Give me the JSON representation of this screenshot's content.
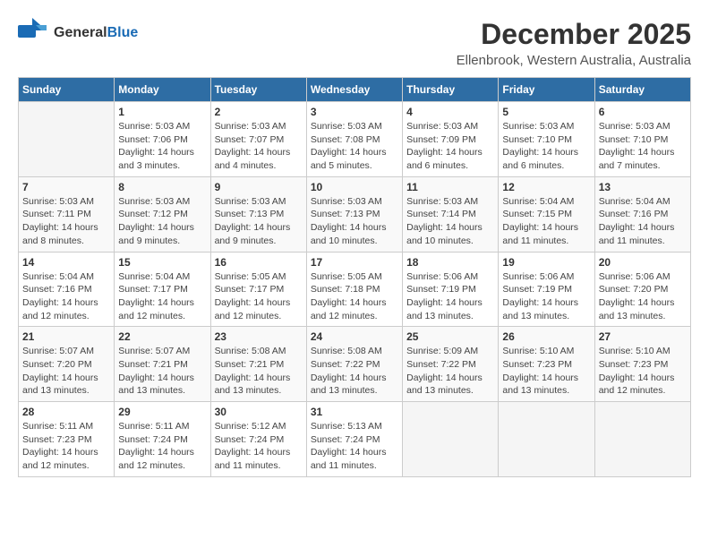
{
  "header": {
    "logo_general": "General",
    "logo_blue": "Blue",
    "main_title": "December 2025",
    "subtitle": "Ellenbrook, Western Australia, Australia"
  },
  "calendar": {
    "days_of_week": [
      "Sunday",
      "Monday",
      "Tuesday",
      "Wednesday",
      "Thursday",
      "Friday",
      "Saturday"
    ],
    "weeks": [
      [
        {
          "day": "",
          "sunrise": "",
          "sunset": "",
          "daylight": "",
          "empty": true
        },
        {
          "day": "1",
          "sunrise": "Sunrise: 5:03 AM",
          "sunset": "Sunset: 7:06 PM",
          "daylight": "Daylight: 14 hours and 3 minutes."
        },
        {
          "day": "2",
          "sunrise": "Sunrise: 5:03 AM",
          "sunset": "Sunset: 7:07 PM",
          "daylight": "Daylight: 14 hours and 4 minutes."
        },
        {
          "day": "3",
          "sunrise": "Sunrise: 5:03 AM",
          "sunset": "Sunset: 7:08 PM",
          "daylight": "Daylight: 14 hours and 5 minutes."
        },
        {
          "day": "4",
          "sunrise": "Sunrise: 5:03 AM",
          "sunset": "Sunset: 7:09 PM",
          "daylight": "Daylight: 14 hours and 6 minutes."
        },
        {
          "day": "5",
          "sunrise": "Sunrise: 5:03 AM",
          "sunset": "Sunset: 7:10 PM",
          "daylight": "Daylight: 14 hours and 6 minutes."
        },
        {
          "day": "6",
          "sunrise": "Sunrise: 5:03 AM",
          "sunset": "Sunset: 7:10 PM",
          "daylight": "Daylight: 14 hours and 7 minutes."
        }
      ],
      [
        {
          "day": "7",
          "sunrise": "Sunrise: 5:03 AM",
          "sunset": "Sunset: 7:11 PM",
          "daylight": "Daylight: 14 hours and 8 minutes."
        },
        {
          "day": "8",
          "sunrise": "Sunrise: 5:03 AM",
          "sunset": "Sunset: 7:12 PM",
          "daylight": "Daylight: 14 hours and 9 minutes."
        },
        {
          "day": "9",
          "sunrise": "Sunrise: 5:03 AM",
          "sunset": "Sunset: 7:13 PM",
          "daylight": "Daylight: 14 hours and 9 minutes."
        },
        {
          "day": "10",
          "sunrise": "Sunrise: 5:03 AM",
          "sunset": "Sunset: 7:13 PM",
          "daylight": "Daylight: 14 hours and 10 minutes."
        },
        {
          "day": "11",
          "sunrise": "Sunrise: 5:03 AM",
          "sunset": "Sunset: 7:14 PM",
          "daylight": "Daylight: 14 hours and 10 minutes."
        },
        {
          "day": "12",
          "sunrise": "Sunrise: 5:04 AM",
          "sunset": "Sunset: 7:15 PM",
          "daylight": "Daylight: 14 hours and 11 minutes."
        },
        {
          "day": "13",
          "sunrise": "Sunrise: 5:04 AM",
          "sunset": "Sunset: 7:16 PM",
          "daylight": "Daylight: 14 hours and 11 minutes."
        }
      ],
      [
        {
          "day": "14",
          "sunrise": "Sunrise: 5:04 AM",
          "sunset": "Sunset: 7:16 PM",
          "daylight": "Daylight: 14 hours and 12 minutes."
        },
        {
          "day": "15",
          "sunrise": "Sunrise: 5:04 AM",
          "sunset": "Sunset: 7:17 PM",
          "daylight": "Daylight: 14 hours and 12 minutes."
        },
        {
          "day": "16",
          "sunrise": "Sunrise: 5:05 AM",
          "sunset": "Sunset: 7:17 PM",
          "daylight": "Daylight: 14 hours and 12 minutes."
        },
        {
          "day": "17",
          "sunrise": "Sunrise: 5:05 AM",
          "sunset": "Sunset: 7:18 PM",
          "daylight": "Daylight: 14 hours and 12 minutes."
        },
        {
          "day": "18",
          "sunrise": "Sunrise: 5:06 AM",
          "sunset": "Sunset: 7:19 PM",
          "daylight": "Daylight: 14 hours and 13 minutes."
        },
        {
          "day": "19",
          "sunrise": "Sunrise: 5:06 AM",
          "sunset": "Sunset: 7:19 PM",
          "daylight": "Daylight: 14 hours and 13 minutes."
        },
        {
          "day": "20",
          "sunrise": "Sunrise: 5:06 AM",
          "sunset": "Sunset: 7:20 PM",
          "daylight": "Daylight: 14 hours and 13 minutes."
        }
      ],
      [
        {
          "day": "21",
          "sunrise": "Sunrise: 5:07 AM",
          "sunset": "Sunset: 7:20 PM",
          "daylight": "Daylight: 14 hours and 13 minutes."
        },
        {
          "day": "22",
          "sunrise": "Sunrise: 5:07 AM",
          "sunset": "Sunset: 7:21 PM",
          "daylight": "Daylight: 14 hours and 13 minutes."
        },
        {
          "day": "23",
          "sunrise": "Sunrise: 5:08 AM",
          "sunset": "Sunset: 7:21 PM",
          "daylight": "Daylight: 14 hours and 13 minutes."
        },
        {
          "day": "24",
          "sunrise": "Sunrise: 5:08 AM",
          "sunset": "Sunset: 7:22 PM",
          "daylight": "Daylight: 14 hours and 13 minutes."
        },
        {
          "day": "25",
          "sunrise": "Sunrise: 5:09 AM",
          "sunset": "Sunset: 7:22 PM",
          "daylight": "Daylight: 14 hours and 13 minutes."
        },
        {
          "day": "26",
          "sunrise": "Sunrise: 5:10 AM",
          "sunset": "Sunset: 7:23 PM",
          "daylight": "Daylight: 14 hours and 13 minutes."
        },
        {
          "day": "27",
          "sunrise": "Sunrise: 5:10 AM",
          "sunset": "Sunset: 7:23 PM",
          "daylight": "Daylight: 14 hours and 12 minutes."
        }
      ],
      [
        {
          "day": "28",
          "sunrise": "Sunrise: 5:11 AM",
          "sunset": "Sunset: 7:23 PM",
          "daylight": "Daylight: 14 hours and 12 minutes."
        },
        {
          "day": "29",
          "sunrise": "Sunrise: 5:11 AM",
          "sunset": "Sunset: 7:24 PM",
          "daylight": "Daylight: 14 hours and 12 minutes."
        },
        {
          "day": "30",
          "sunrise": "Sunrise: 5:12 AM",
          "sunset": "Sunset: 7:24 PM",
          "daylight": "Daylight: 14 hours and 11 minutes."
        },
        {
          "day": "31",
          "sunrise": "Sunrise: 5:13 AM",
          "sunset": "Sunset: 7:24 PM",
          "daylight": "Daylight: 14 hours and 11 minutes."
        },
        {
          "day": "",
          "sunrise": "",
          "sunset": "",
          "daylight": "",
          "empty": true
        },
        {
          "day": "",
          "sunrise": "",
          "sunset": "",
          "daylight": "",
          "empty": true
        },
        {
          "day": "",
          "sunrise": "",
          "sunset": "",
          "daylight": "",
          "empty": true
        }
      ]
    ]
  }
}
